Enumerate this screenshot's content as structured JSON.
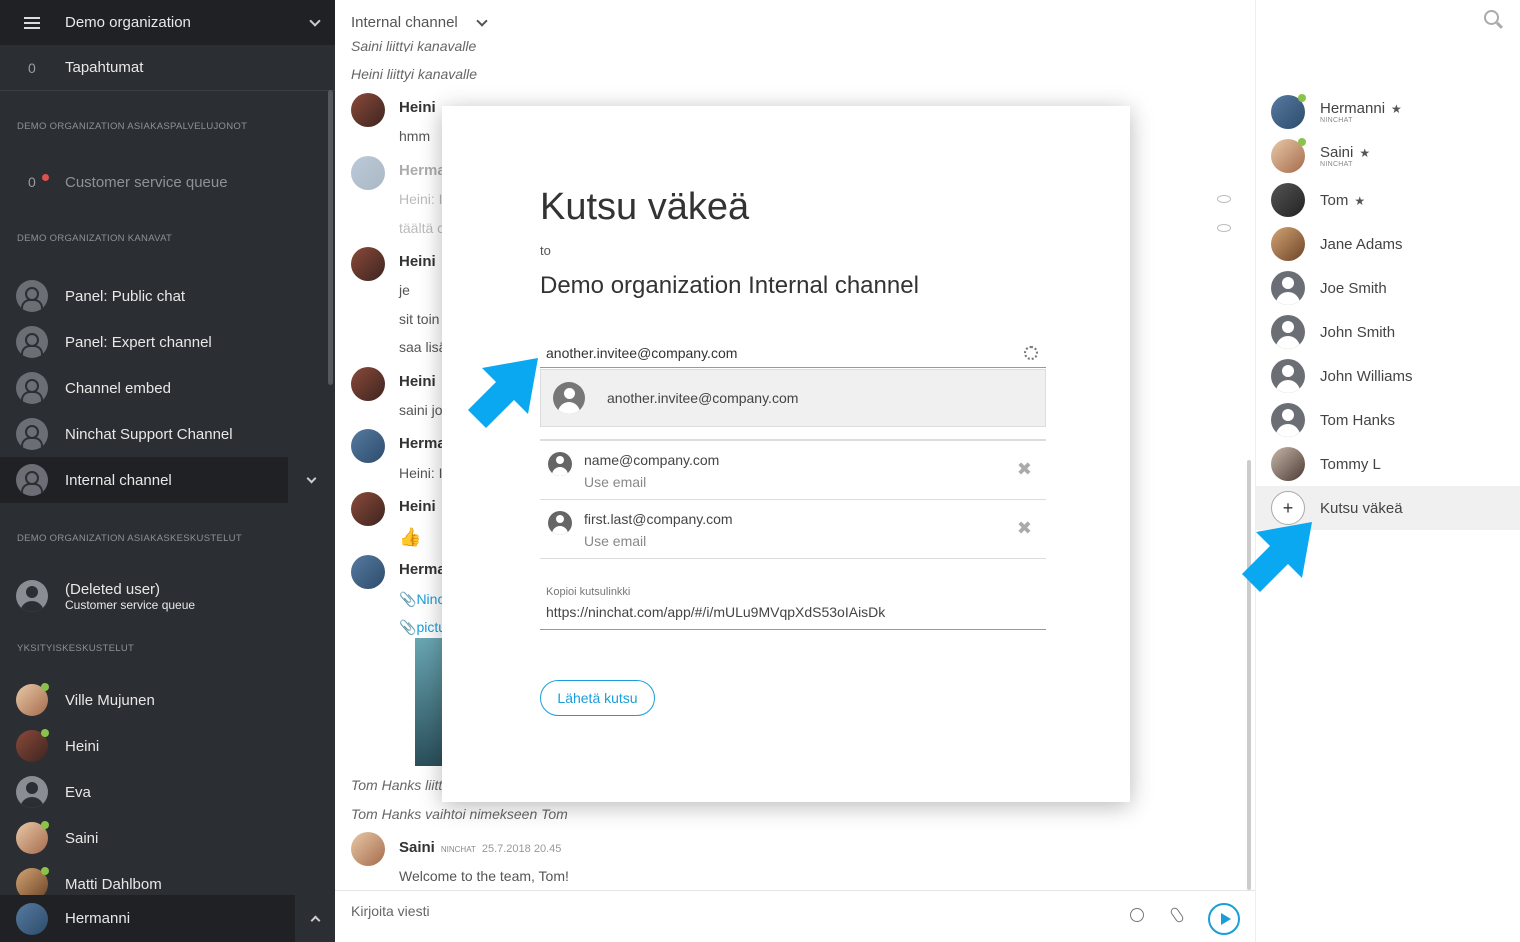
{
  "sidebar": {
    "org_name": "Demo organization",
    "events": {
      "count": "0",
      "label": "Tapahtumat"
    },
    "sections": {
      "queues": "DEMO ORGANIZATION ASIAKASPALVELUJONOT",
      "channels": "DEMO ORGANIZATION KANAVAT",
      "customer_chats": "DEMO ORGANIZATION ASIAKASKESKUSTELUT",
      "private": "YKSITYISKESKUSTELUT"
    },
    "queue": {
      "count": "0",
      "label": "Customer service queue"
    },
    "channels": [
      {
        "label": "Panel: Public chat"
      },
      {
        "label": "Panel: Expert channel"
      },
      {
        "label": "Channel embed"
      },
      {
        "label": "Ninchat Support Channel"
      },
      {
        "label": "Internal channel"
      }
    ],
    "customer_chat": {
      "name": "(Deleted user)",
      "queue": "Customer service queue"
    },
    "private_chats": [
      {
        "label": "Ville Mujunen"
      },
      {
        "label": "Heini"
      },
      {
        "label": "Eva"
      },
      {
        "label": "Saini"
      },
      {
        "label": "Matti Dahlbom"
      }
    ],
    "self": {
      "label": "Hermanni"
    }
  },
  "chat": {
    "title": "Internal channel",
    "messages": {
      "sys1": "Saini liittyi kanavalle",
      "sys2": "Heini liittyi kanavalle",
      "m1_name": "Heini",
      "m1_text": "hmm",
      "m2_name": "Herma",
      "m2_text1": "Heini: I",
      "m2_text2": "täältä c",
      "m3_name": "Heini",
      "m3_text1": "je",
      "m3_text2": "sit toin",
      "m3_text3": "saa lisä",
      "m4_name": "Heini",
      "m4_text": "saini jo",
      "m5_name": "Herma",
      "m5_text": "Heini: I",
      "m6_name": "Heini",
      "m6_text": "👍",
      "m7_name": "Herma",
      "m7_link1": "Ninc",
      "m7_link2": "pictu",
      "sys3": "Tom Hanks liitt",
      "sys4": "Tom Hanks vaihtoi nimekseen Tom",
      "last_name": "Saini",
      "last_tag": "NINCHAT",
      "last_time": "25.7.2018 20.45",
      "last_text": "Welcome to the team, Tom!"
    },
    "composer_placeholder": "Kirjoita viesti"
  },
  "members": [
    {
      "name": "Hermanni",
      "sub": "NINCHAT",
      "star": "★"
    },
    {
      "name": "Saini",
      "sub": "NINCHAT",
      "star": "★"
    },
    {
      "name": "Tom",
      "sub": "",
      "star": "★"
    },
    {
      "name": "Jane Adams"
    },
    {
      "name": "Joe Smith"
    },
    {
      "name": "John Smith"
    },
    {
      "name": "John Williams"
    },
    {
      "name": "Tom Hanks"
    },
    {
      "name": "Tommy L"
    }
  ],
  "invite_member_label": "Kutsu väkeä",
  "modal": {
    "title": "Kutsu väkeä",
    "to": "to",
    "channel": "Demo organization Internal channel",
    "input_value": "another.invitee@company.com",
    "suggestion": "another.invitee@company.com",
    "invitees": [
      {
        "email": "name@company.com",
        "hint": "Use email"
      },
      {
        "email": "first.last@company.com",
        "hint": "Use email"
      }
    ],
    "link_label": "Kopioi kutsulinkki",
    "link": "https://ninchat.com/app/#/i/mULu9MVqpXdS53oIAisDk",
    "send_label": "Lähetä kutsu"
  },
  "colors": {
    "accent": "#1a9ed9",
    "sidebar": "#2b2e32",
    "online": "#8bc34a",
    "arrow": "#0aa8f0"
  }
}
